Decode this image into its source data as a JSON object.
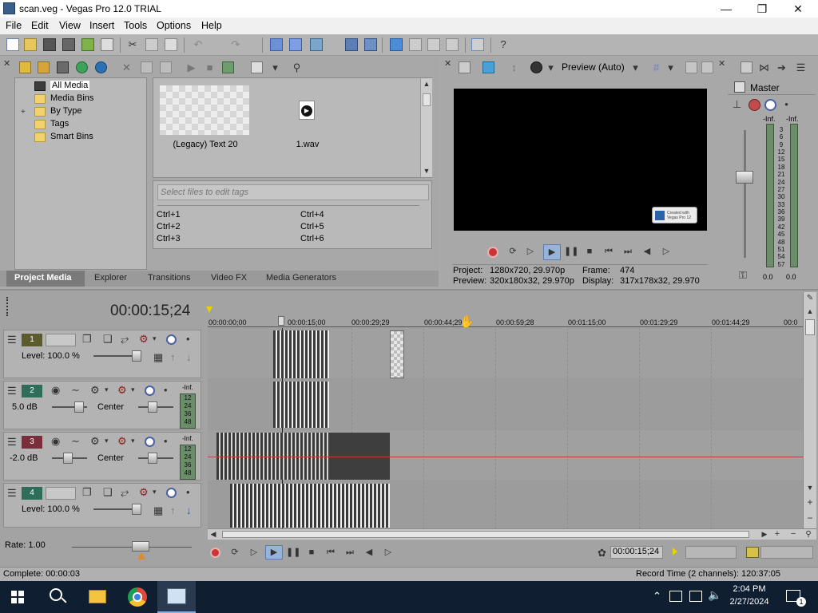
{
  "window": {
    "title": "scan.veg - Vegas Pro 12.0 TRIAL",
    "minimize_icon": "minimize-icon",
    "maximize_icon": "restore-icon",
    "close_icon": "close-icon"
  },
  "menu": [
    "File",
    "Edit",
    "View",
    "Insert",
    "Tools",
    "Options",
    "Help"
  ],
  "project_media": {
    "tree": [
      "All Media",
      "Media Bins",
      "By Type",
      "Tags",
      "Smart Bins"
    ],
    "files": [
      {
        "name": "(Legacy) Text 20",
        "kind": "text"
      },
      {
        "name": "1.wav",
        "kind": "audio"
      }
    ],
    "tags_placeholder": "Select files to edit tags",
    "shortcuts": [
      "Ctrl+1",
      "Ctrl+4",
      "Ctrl+2",
      "Ctrl+5",
      "Ctrl+3",
      "Ctrl+6"
    ],
    "tabs": [
      "Project Media",
      "Explorer",
      "Transitions",
      "Video FX",
      "Media Generators"
    ]
  },
  "preview": {
    "mode": "Preview (Auto)",
    "watermark": "Created with Vegas Pro 12",
    "project_label": "Project:",
    "project_value": "1280x720, 29.970p",
    "frame_label": "Frame:",
    "frame_value": "474",
    "preview_label": "Preview:",
    "preview_value": "320x180x32, 29.970p",
    "display_label": "Display:",
    "display_value": "317x178x32, 29.970"
  },
  "master": {
    "label": "Master",
    "left_peak": "-Inf.",
    "right_peak": "-Inf.",
    "scale": [
      "3",
      "6",
      "9",
      "12",
      "15",
      "18",
      "21",
      "24",
      "27",
      "30",
      "33",
      "36",
      "39",
      "42",
      "45",
      "48",
      "51",
      "54",
      "57"
    ],
    "left_value": "0.0",
    "right_value": "0.0"
  },
  "timeline": {
    "timecode": "00:00:15;24",
    "ruler": [
      "00:00:00;00",
      "00:00:15;00",
      "00:00:29;29",
      "00:00:44;29",
      "00:00:59;28",
      "00:01:15;00",
      "00:01:29;29",
      "00:01:44;29",
      "00:0"
    ],
    "tracks": [
      {
        "num": "1",
        "type": "video",
        "level": "Level: 100.0 %"
      },
      {
        "num": "2",
        "type": "audio",
        "vol": "5.0 dB",
        "pan": "Center",
        "peak": "-Inf.",
        "scale": [
          "12",
          "24",
          "36",
          "48"
        ]
      },
      {
        "num": "3",
        "type": "audio",
        "vol": "-2.0 dB",
        "pan": "Center",
        "peak": "-Inf.",
        "scale": [
          "12",
          "24",
          "36",
          "48"
        ]
      },
      {
        "num": "4",
        "type": "video",
        "level": "Level: 100.0 %"
      }
    ],
    "rate": "Rate: 1.00",
    "transport_timecode": "00:00:15;24",
    "complete": "Complete: 00:00:03",
    "record_time": "Record Time (2 channels): 120:37:05"
  },
  "taskbar": {
    "time": "2:04 PM",
    "date": "2/27/2024",
    "notification_count": "1"
  },
  "colors": {
    "track1": "#5b5b2e",
    "track2": "#2d6d5a",
    "track3": "#7a2d3a",
    "track4": "#2d6d5a",
    "accent": "#2b78d0"
  }
}
